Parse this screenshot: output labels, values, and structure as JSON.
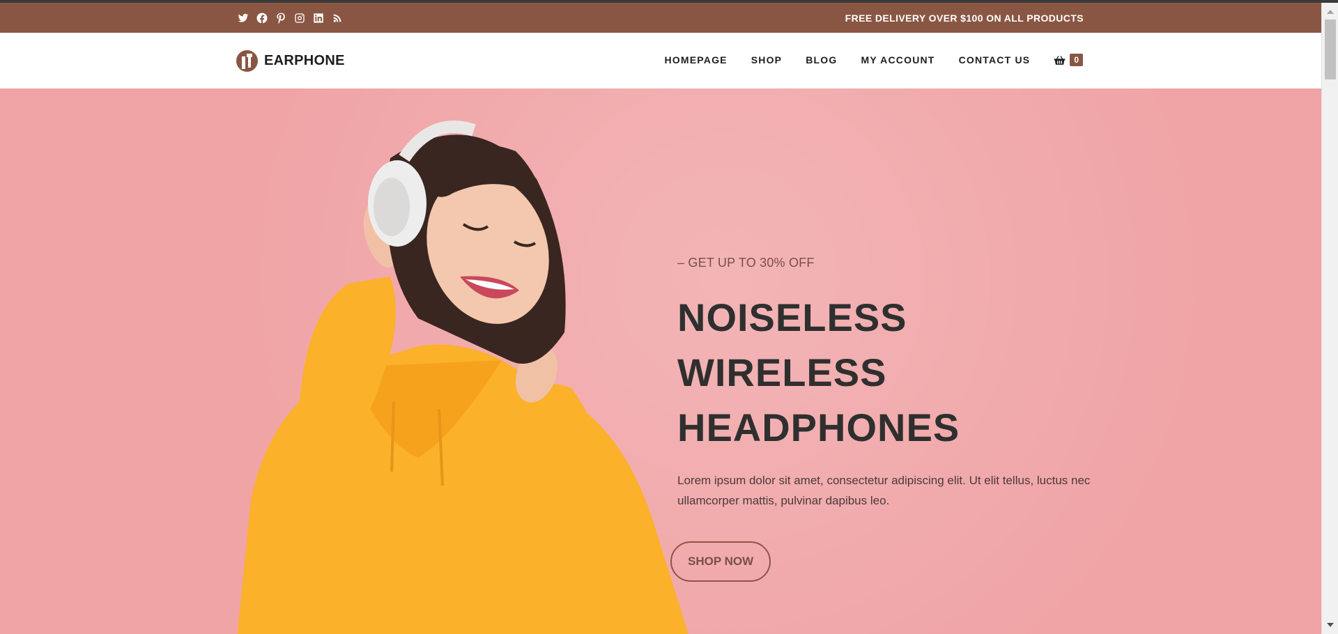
{
  "topbar": {
    "social_icons": [
      "twitter-icon",
      "facebook-icon",
      "pinterest-icon",
      "instagram-icon",
      "linkedin-icon",
      "rss-icon"
    ],
    "promo": "FREE DELIVERY OVER $100 ON ALL PRODUCTS"
  },
  "header": {
    "logo_text": "EARPHONE",
    "nav": [
      "HOMEPAGE",
      "SHOP",
      "BLOG",
      "MY ACCOUNT",
      "CONTACT US"
    ],
    "cart_count": "0"
  },
  "hero": {
    "eyebrow": "– GET UP TO 30% OFF",
    "headline": [
      "NOISELESS",
      "WIRELESS",
      "HEADPHONES"
    ],
    "lead": "Lorem ipsum dolor sit amet, consectetur adipiscing elit. Ut elit tellus, luctus nec ullamcorper mattis, pulvinar dapibus leo.",
    "cta": "SHOP NOW"
  },
  "colors": {
    "brand": "#8a5644",
    "hero_bg": "#f0a4a6",
    "text_dark": "#2f2f2f"
  }
}
